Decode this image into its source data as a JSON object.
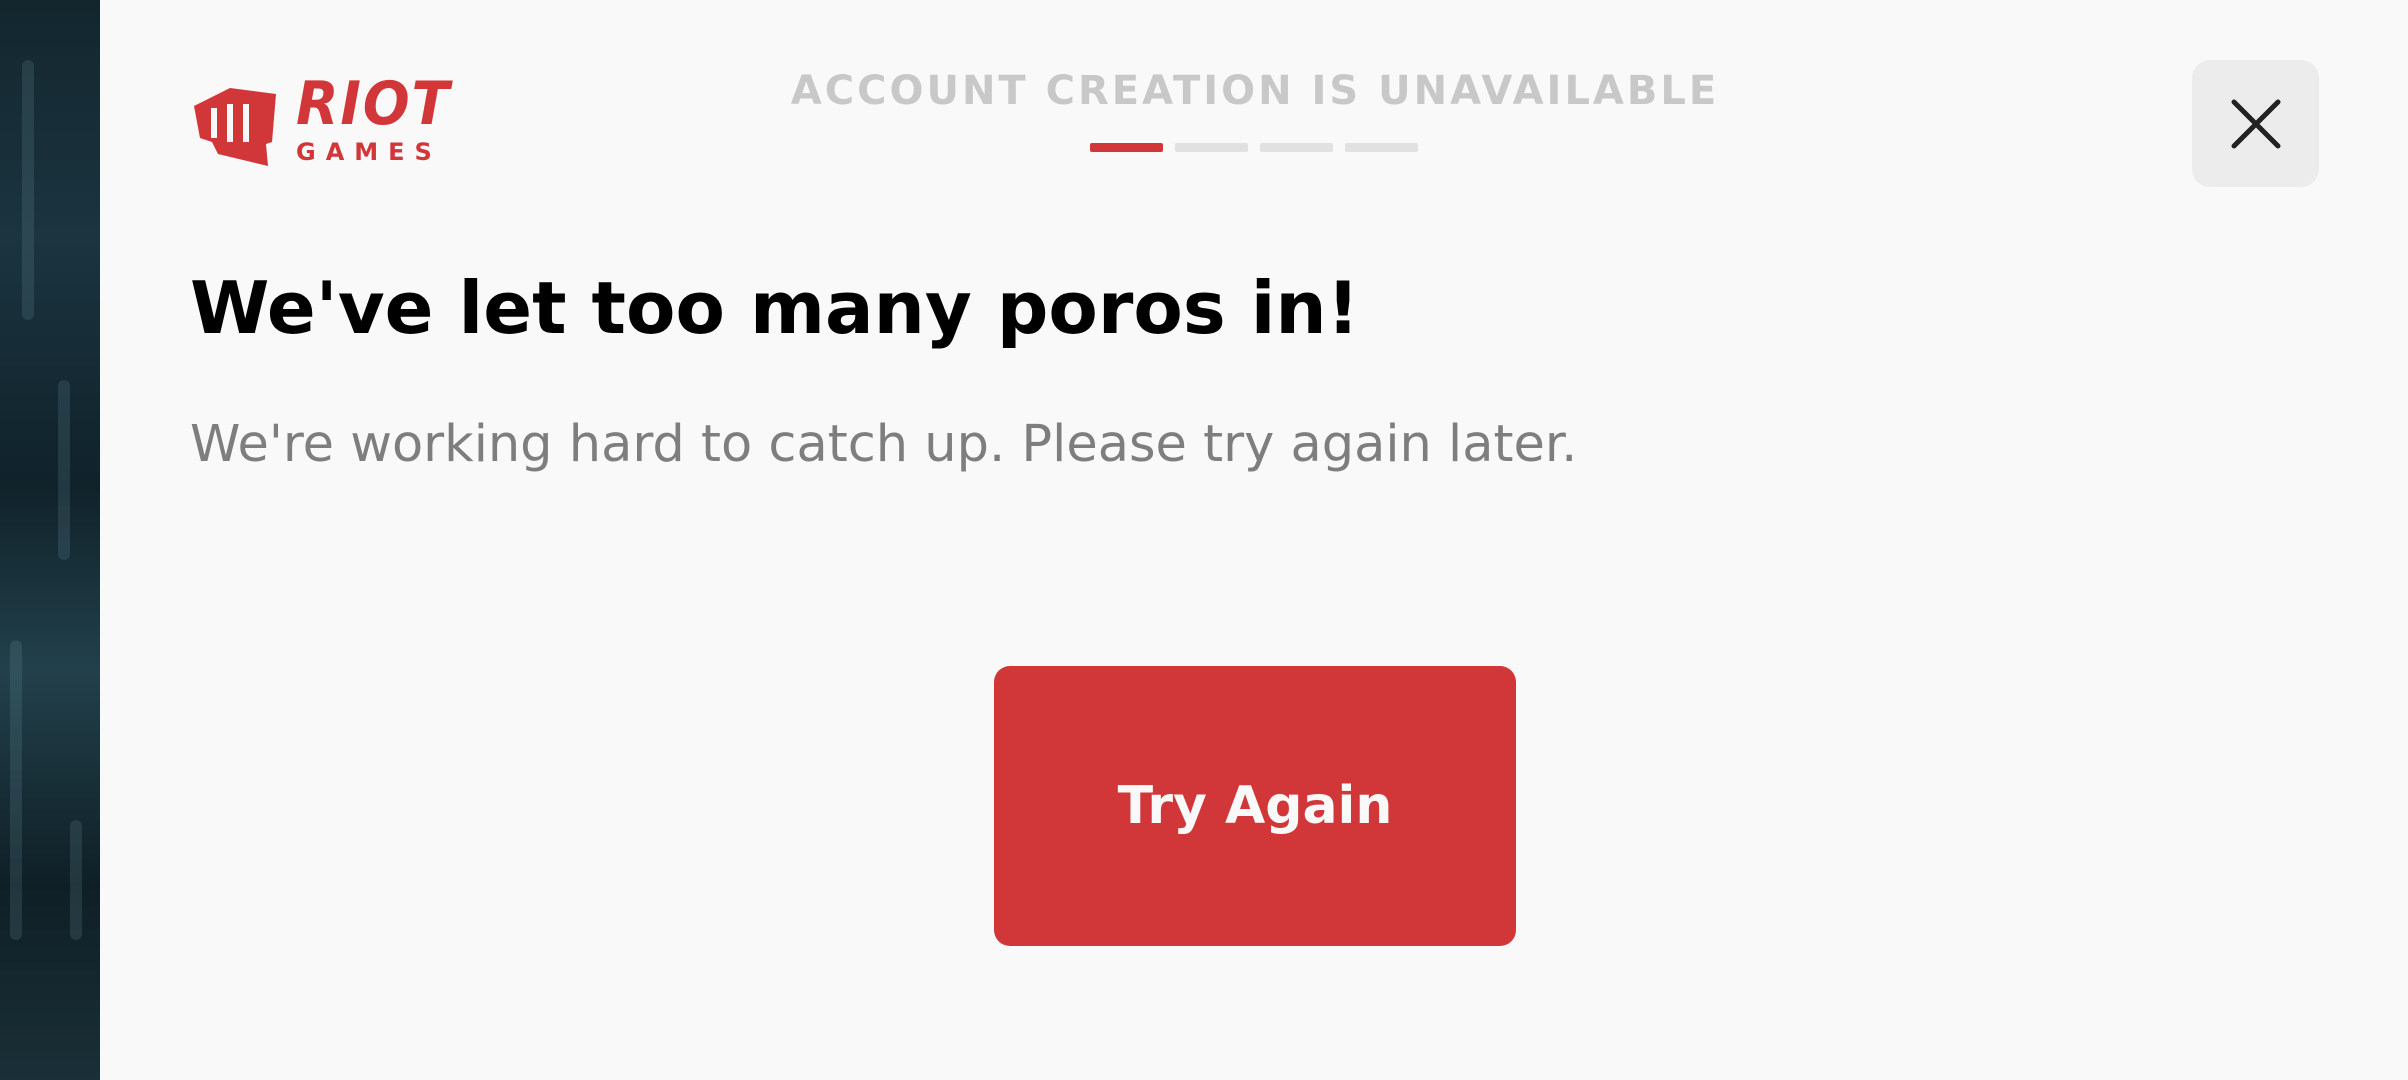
{
  "brand": {
    "logo_line1": "RIOT",
    "logo_line2": "GAMES",
    "accent_color": "#d13639"
  },
  "header": {
    "step_title": "ACCOUNT CREATION IS UNAVAILABLE",
    "progress": {
      "total_steps": 4,
      "current_step": 1
    },
    "close_icon": "close-icon"
  },
  "main": {
    "heading": "We've let too many poros in!",
    "message": "We're working hard to catch up. Please try again later.",
    "primary_button_label": "Try Again"
  }
}
